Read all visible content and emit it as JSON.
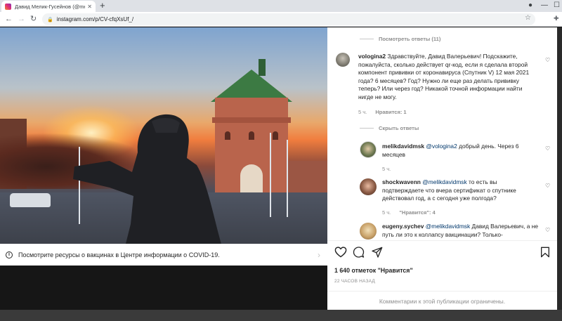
{
  "browser": {
    "tab_title": "Давид Мелик-Гусейнов (@melik",
    "url": "instagram.com/p/CV-cfqXsUf_/"
  },
  "banner": {
    "text": "Посмотрите ресурсы о вакцинах в Центре информации о COVID-19."
  },
  "comments": {
    "show_replies": "Посмотреть ответы (11)",
    "main": {
      "username": "vologina2",
      "text": "Здравствуйте, Давид Валерьевич! Подскажите, пожалуйста, сколько действует qr-код, если я сделала второй компонент прививки от коронавируса (Спутник V) 12 мая 2021 года? 6 месяцев? Год? Нужно ли еще раз делать прививку теперь? Или через год? Никакой точной информации найти нигде не могу.",
      "time": "5 ч.",
      "likes": "Нравится: 1"
    },
    "hide_replies": "Скрыть ответы",
    "replies": [
      {
        "username": "melikdavidmsk",
        "mention": "@vologina2",
        "text": "добрый день. Через 6 месяцев",
        "time": "5 ч."
      },
      {
        "username": "shockwavenn",
        "mention": "@melikdavidmsk",
        "text": "то есть вы подтверждаете что вчера сертификат о спутнике действовал год, а с сегодня уже полгода?",
        "time": "5 ч.",
        "likes": "\"Нравится\": 4"
      },
      {
        "username": "eugeny.sychev",
        "mention": "@melikdavidmsk",
        "text": "Давид Валерьевич, а не путь ли это к коллапсу вакцинации? Только-"
      }
    ]
  },
  "post": {
    "likes": "1 640 отметок \"Нравится\"",
    "time": "22 ЧАСОВ НАЗАД",
    "comments_limited": "Комментарии к этой публикации ограничены."
  }
}
